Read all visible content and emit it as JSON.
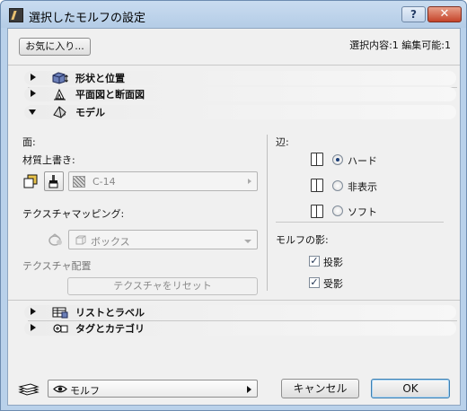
{
  "window": {
    "title": "選択したモルフの設定",
    "help_label": "?",
    "close_label": "✕"
  },
  "header": {
    "favorites_label": "お気に入り...",
    "selection_info": "選択内容:1 編集可能:1"
  },
  "sections": [
    {
      "label": "形状と位置",
      "expanded": false,
      "icon": "box-dimension-icon"
    },
    {
      "label": "平面図と断面図",
      "expanded": false,
      "icon": "plan-section-icon"
    },
    {
      "label": "モデル",
      "expanded": true,
      "icon": "model-shading-icon"
    },
    {
      "label": "リストとラベル",
      "expanded": false,
      "icon": "list-label-icon"
    },
    {
      "label": "タグとカテゴリ",
      "expanded": false,
      "icon": "tag-category-icon"
    }
  ],
  "model": {
    "face_label": "面:",
    "material_override_label": "材質上書き:",
    "material_value": "C-14",
    "texture_mapping_label": "テクスチャマッピング:",
    "texture_mapping_value": "ボックス",
    "texture_placement_label": "テクスチャ配置",
    "reset_texture_label": "テクスチャをリセット",
    "edge_label": "辺:",
    "edge_options": [
      {
        "label": "ハード",
        "selected": true
      },
      {
        "label": "非表示",
        "selected": false
      },
      {
        "label": "ソフト",
        "selected": false
      }
    ],
    "shadow_label": "モルフの影:",
    "cast_shadow_label": "投影",
    "cast_shadow_checked": true,
    "receive_shadow_label": "受影",
    "receive_shadow_checked": true,
    "check_glyph": "✓"
  },
  "footer": {
    "layer_value": "モルフ",
    "cancel_label": "キャンセル",
    "ok_label": "OK"
  }
}
